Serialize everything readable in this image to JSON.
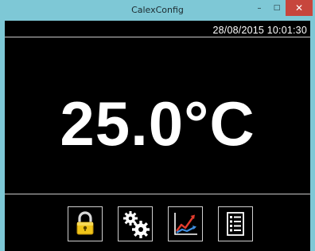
{
  "window": {
    "title": "CalexConfig",
    "minimize_glyph": "–",
    "maximize_glyph": "□",
    "close_glyph": "✕"
  },
  "display": {
    "datetime": "28/08/2015 10:01:30",
    "temperature": "25.0°C"
  },
  "toolbar": {
    "buttons": [
      {
        "icon": "lock-icon",
        "color": "#f0c419"
      },
      {
        "icon": "gears-icon",
        "color": "#ffffff"
      },
      {
        "icon": "trend-chart-icon",
        "color": "#e23c2e"
      },
      {
        "icon": "list-icon",
        "color": "#ffffff"
      }
    ]
  },
  "colors": {
    "titlebar": "#7ec8d6",
    "close_button": "#c7463d",
    "display_background": "#000000",
    "text": "#ffffff"
  }
}
